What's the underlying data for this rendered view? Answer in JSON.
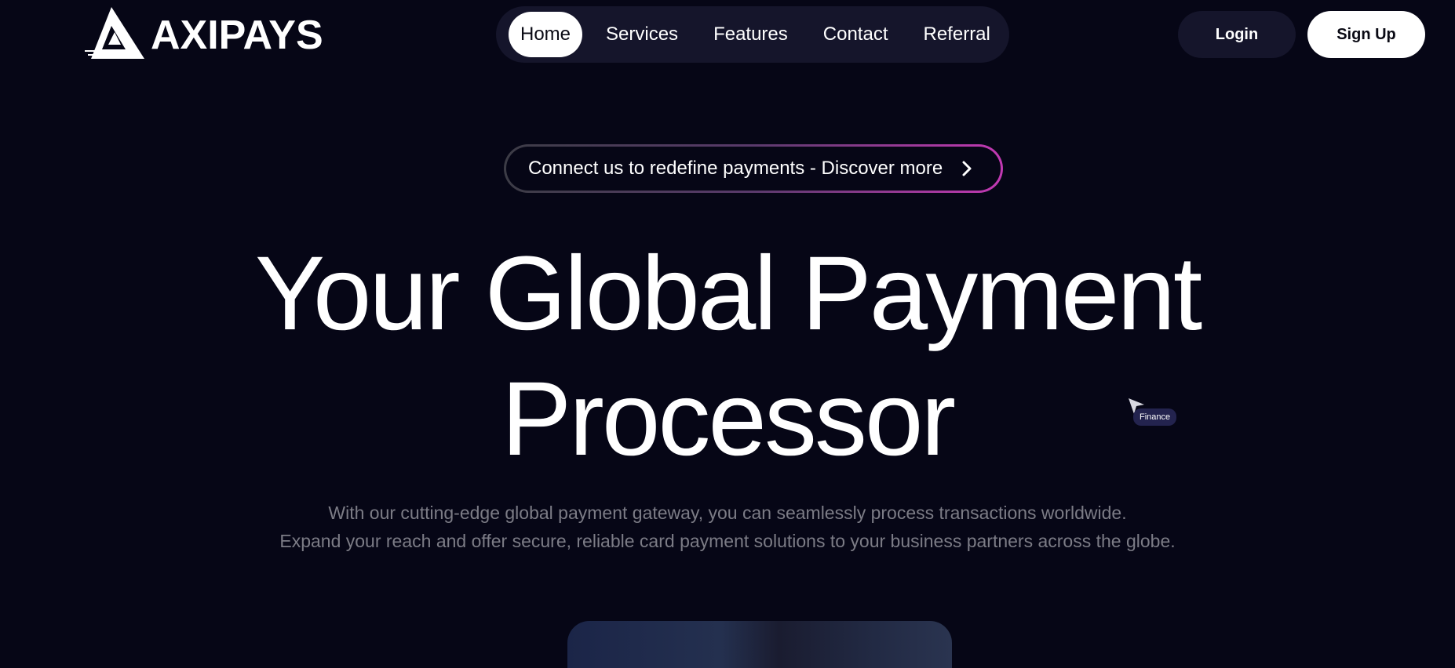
{
  "brand": {
    "name": "AXIPAYS"
  },
  "nav": {
    "items": [
      {
        "label": "Home",
        "active": true
      },
      {
        "label": "Services",
        "active": false
      },
      {
        "label": "Features",
        "active": false
      },
      {
        "label": "Contact",
        "active": false
      },
      {
        "label": "Referral",
        "active": false
      }
    ]
  },
  "auth": {
    "login_label": "Login",
    "signup_label": "Sign Up"
  },
  "announcement": {
    "text": "Connect us to redefine payments - Discover more",
    "icon": "chevron-right-icon"
  },
  "hero": {
    "title_line1": "Your Global Payment",
    "title_line2": "Processor",
    "subtitle_line1": "With our cutting-edge global payment gateway, you can seamlessly process transactions worldwide.",
    "subtitle_line2": "Expand your reach and offer secure, reliable card payment solutions to your business partners across the globe."
  },
  "cursor_tag": {
    "label": "Finance"
  },
  "colors": {
    "background": "#060616",
    "nav_background": "#15152b",
    "accent_gradient_end": "#c239b3",
    "subtitle": "#7c7c86"
  }
}
